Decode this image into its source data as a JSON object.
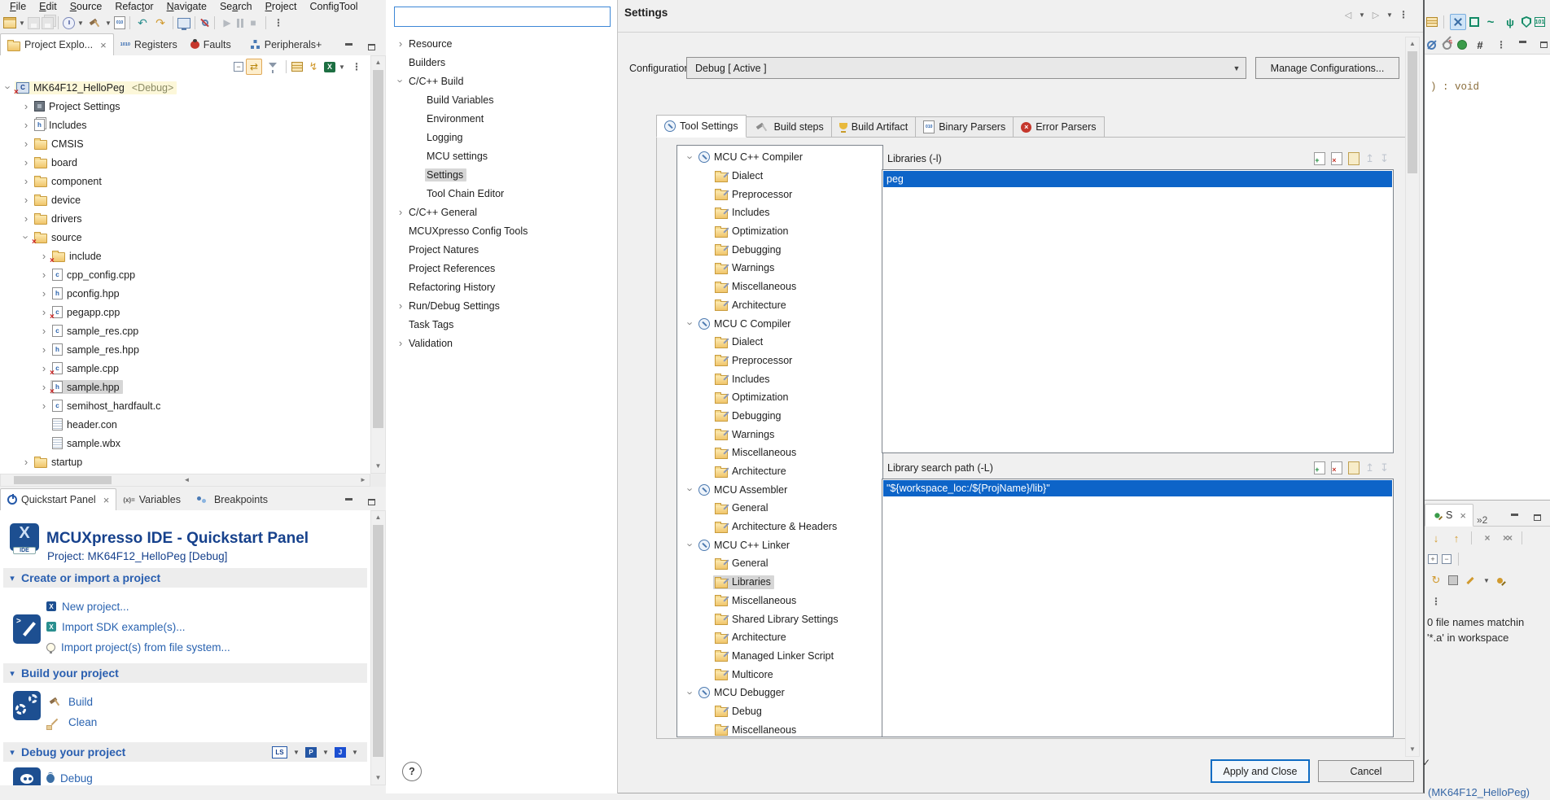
{
  "menu": {
    "items": [
      "File",
      "Edit",
      "Source",
      "Refactor",
      "Navigate",
      "Search",
      "Project",
      "ConfigTool"
    ]
  },
  "main_toolbar": {
    "left_icons": [
      "new-wizard",
      "dropdown",
      "save",
      "save-all",
      "sep",
      "debug-config",
      "dropdown",
      "build-hammer",
      "dropdown",
      "binary-doc",
      "sep",
      "undo",
      "redo",
      "sep",
      "console",
      "sep",
      "search-mark",
      "sep",
      "resume",
      "pause",
      "stop",
      "sep2",
      "overflow"
    ],
    "right_icons": [
      "table-add",
      "sep",
      "dev-tools",
      "green-chip",
      "signal",
      "usb",
      "shield",
      "binary-101"
    ],
    "right_icons2": [
      "skip-breakpoint",
      "skip-s",
      "record-dot",
      "grid-cross",
      "overflow",
      "minimize",
      "maximize"
    ]
  },
  "explorer": {
    "tabs": [
      {
        "label": "Project Explo...",
        "icon": "folder-tab",
        "active": true,
        "close": true
      },
      {
        "label": "Registers",
        "icon": "registers"
      },
      {
        "label": "Faults",
        "icon": "ladybug"
      },
      {
        "label": "Peripherals+",
        "icon": "network"
      }
    ],
    "toolbar_icons": [
      "collapse-all",
      "link-editor",
      "filter",
      "sep",
      "table",
      "sync",
      "excel",
      "dropdown",
      "overflow"
    ],
    "tree": [
      {
        "t": "MK64F12_HelloPeg",
        "sfx": "<Debug>",
        "d": 0,
        "e": "v",
        "i": "proj",
        "hl": true
      },
      {
        "t": "Project Settings",
        "d": 1,
        "e": ">",
        "i": "chip"
      },
      {
        "t": "Includes",
        "d": 1,
        "e": ">",
        "i": "includes"
      },
      {
        "t": "CMSIS",
        "d": 1,
        "e": ">",
        "i": "folder"
      },
      {
        "t": "board",
        "d": 1,
        "e": ">",
        "i": "folder"
      },
      {
        "t": "component",
        "d": 1,
        "e": ">",
        "i": "folder"
      },
      {
        "t": "device",
        "d": 1,
        "e": ">",
        "i": "folder"
      },
      {
        "t": "drivers",
        "d": 1,
        "e": ">",
        "i": "folder"
      },
      {
        "t": "source",
        "d": 1,
        "e": "v",
        "i": "folder-x"
      },
      {
        "t": "include",
        "d": 2,
        "e": ">",
        "i": "folder-x"
      },
      {
        "t": "cpp_config.cpp",
        "d": 2,
        "e": ">",
        "i": "file-c"
      },
      {
        "t": "pconfig.hpp",
        "d": 2,
        "e": ">",
        "i": "file-h"
      },
      {
        "t": "pegapp.cpp",
        "d": 2,
        "e": ">",
        "i": "file-c-x"
      },
      {
        "t": "sample_res.cpp",
        "d": 2,
        "e": ">",
        "i": "file-c"
      },
      {
        "t": "sample_res.hpp",
        "d": 2,
        "e": ">",
        "i": "file-h"
      },
      {
        "t": "sample.cpp",
        "d": 2,
        "e": ">",
        "i": "file-c-x"
      },
      {
        "t": "sample.hpp",
        "d": 2,
        "e": ">",
        "i": "file-h-x",
        "sel": true
      },
      {
        "t": "semihost_hardfault.c",
        "d": 2,
        "e": ">",
        "i": "file-c"
      },
      {
        "t": "header.con",
        "d": 2,
        "i": "doc"
      },
      {
        "t": "sample.wbx",
        "d": 2,
        "i": "doc"
      },
      {
        "t": "startup",
        "d": 1,
        "e": ">",
        "i": "folder"
      }
    ]
  },
  "quickstart": {
    "tabs": [
      {
        "label": "Quickstart Panel",
        "icon": "power",
        "active": true,
        "close": true
      },
      {
        "label": "Variables",
        "icon": "variables"
      },
      {
        "label": "Breakpoints",
        "icon": "breakpoints"
      }
    ],
    "title": "MCUXpresso IDE - Quickstart Panel",
    "subtitle": "Project: MK64F12_HelloPeg [Debug]",
    "sections": [
      {
        "header": "Create or import a project",
        "big_icon": "import-project",
        "links": [
          {
            "label": "New project...",
            "icon": "x-blue"
          },
          {
            "label": "Import SDK example(s)...",
            "icon": "x-teal"
          },
          {
            "label": "Import project(s) from file system...",
            "icon": "bulb"
          }
        ]
      },
      {
        "header": "Build your project",
        "big_icon": "build-gears",
        "links": [
          {
            "label": "Build",
            "icon": "hammer"
          },
          {
            "label": "Clean",
            "icon": "broom"
          }
        ]
      },
      {
        "header": "Debug your project",
        "big_icon": "debug-probe",
        "header_icons": [
          "link-server",
          "dropdown",
          "pemicro",
          "dropdown",
          "jlink",
          "dropdown"
        ],
        "links": [
          {
            "label": "Debug",
            "icon": "bug"
          }
        ]
      }
    ]
  },
  "dialog": {
    "filter_value": "",
    "nav_arrows": [
      "back",
      "dropdown",
      "forward",
      "dropdown",
      "overflow"
    ],
    "nav": [
      {
        "t": "Resource",
        "d": 0,
        "e": ">"
      },
      {
        "t": "Builders",
        "d": 0
      },
      {
        "t": "C/C++ Build",
        "d": 0,
        "e": "v"
      },
      {
        "t": "Build Variables",
        "d": 1
      },
      {
        "t": "Environment",
        "d": 1
      },
      {
        "t": "Logging",
        "d": 1
      },
      {
        "t": "MCU settings",
        "d": 1
      },
      {
        "t": "Settings",
        "d": 1,
        "sel": true
      },
      {
        "t": "Tool Chain Editor",
        "d": 1
      },
      {
        "t": "C/C++ General",
        "d": 0,
        "e": ">"
      },
      {
        "t": "MCUXpresso Config Tools",
        "d": 0
      },
      {
        "t": "Project Natures",
        "d": 0
      },
      {
        "t": "Project References",
        "d": 0
      },
      {
        "t": "Refactoring History",
        "d": 0
      },
      {
        "t": "Run/Debug Settings",
        "d": 0,
        "e": ">"
      },
      {
        "t": "Task Tags",
        "d": 0
      },
      {
        "t": "Validation",
        "d": 0,
        "e": ">"
      }
    ],
    "title": "Settings",
    "config_label": "Configuration:",
    "config_value": "Debug  [ Active ]",
    "manage_button": "Manage Configurations...",
    "tabs": [
      {
        "label": "Tool Settings",
        "icon": "dial",
        "active": true
      },
      {
        "label": "Build steps",
        "icon": "hammer-gray"
      },
      {
        "label": "Build Artifact",
        "icon": "trophy"
      },
      {
        "label": "Binary Parsers",
        "icon": "binary-doc"
      },
      {
        "label": "Error Parsers",
        "icon": "error"
      }
    ],
    "tool_tree": [
      {
        "t": "MCU C++ Compiler",
        "d": 0,
        "e": "v",
        "i": "dial"
      },
      {
        "t": "Dialect",
        "d": 1,
        "i": "tool-folder"
      },
      {
        "t": "Preprocessor",
        "d": 1,
        "i": "tool-folder"
      },
      {
        "t": "Includes",
        "d": 1,
        "i": "tool-folder"
      },
      {
        "t": "Optimization",
        "d": 1,
        "i": "tool-folder"
      },
      {
        "t": "Debugging",
        "d": 1,
        "i": "tool-folder"
      },
      {
        "t": "Warnings",
        "d": 1,
        "i": "tool-folder"
      },
      {
        "t": "Miscellaneous",
        "d": 1,
        "i": "tool-folder"
      },
      {
        "t": "Architecture",
        "d": 1,
        "i": "tool-folder"
      },
      {
        "t": "MCU C Compiler",
        "d": 0,
        "e": "v",
        "i": "dial"
      },
      {
        "t": "Dialect",
        "d": 1,
        "i": "tool-folder"
      },
      {
        "t": "Preprocessor",
        "d": 1,
        "i": "tool-folder"
      },
      {
        "t": "Includes",
        "d": 1,
        "i": "tool-folder"
      },
      {
        "t": "Optimization",
        "d": 1,
        "i": "tool-folder"
      },
      {
        "t": "Debugging",
        "d": 1,
        "i": "tool-folder"
      },
      {
        "t": "Warnings",
        "d": 1,
        "i": "tool-folder"
      },
      {
        "t": "Miscellaneous",
        "d": 1,
        "i": "tool-folder"
      },
      {
        "t": "Architecture",
        "d": 1,
        "i": "tool-folder"
      },
      {
        "t": "MCU Assembler",
        "d": 0,
        "e": "v",
        "i": "dial"
      },
      {
        "t": "General",
        "d": 1,
        "i": "tool-folder"
      },
      {
        "t": "Architecture & Headers",
        "d": 1,
        "i": "tool-folder"
      },
      {
        "t": "MCU C++ Linker",
        "d": 0,
        "e": "v",
        "i": "dial"
      },
      {
        "t": "General",
        "d": 1,
        "i": "tool-folder"
      },
      {
        "t": "Libraries",
        "d": 1,
        "i": "tool-folder",
        "sel": true
      },
      {
        "t": "Miscellaneous",
        "d": 1,
        "i": "tool-folder"
      },
      {
        "t": "Shared Library Settings",
        "d": 1,
        "i": "tool-folder"
      },
      {
        "t": "Architecture",
        "d": 1,
        "i": "tool-folder"
      },
      {
        "t": "Managed Linker Script",
        "d": 1,
        "i": "tool-folder"
      },
      {
        "t": "Multicore",
        "d": 1,
        "i": "tool-folder"
      },
      {
        "t": "MCU Debugger",
        "d": 0,
        "e": "v",
        "i": "dial"
      },
      {
        "t": "Debug",
        "d": 1,
        "i": "tool-folder"
      },
      {
        "t": "Miscellaneous",
        "d": 1,
        "i": "tool-folder"
      }
    ],
    "libraries": {
      "title": "Libraries (-l)",
      "toolbar": [
        "add",
        "delete",
        "edit",
        "move-up",
        "move-down"
      ],
      "rows": [
        "peg"
      ]
    },
    "search_path": {
      "title": "Library search path (-L)",
      "toolbar": [
        "add",
        "delete",
        "edit",
        "move-up",
        "move-down"
      ],
      "rows": [
        "\"${workspace_loc:/${ProjName}/lib}\""
      ]
    },
    "help_button": "?",
    "apply_button": "Apply and Close",
    "cancel_button": "Cancel"
  },
  "editor": {
    "code_fragment": ") : void"
  },
  "search_view": {
    "tabs": [
      {
        "label": "S",
        "icon": "pin-green",
        "active": true,
        "close": true
      },
      {
        "label": "»2"
      }
    ],
    "toolbar1": [
      "arrow-down",
      "arrow-up",
      "sep",
      "remove",
      "remove-all",
      "sep"
    ],
    "toolbar2": [
      "expand-all",
      "collapse-tree",
      "sep"
    ],
    "toolbar3": [
      "refresh",
      "stop-gray",
      "edit-search",
      "dropdown",
      "pin-view"
    ],
    "overflow_icon": "overflow",
    "message_line1": "0 file names matchin",
    "message_line2": "'*.a' in workspace"
  },
  "statusbar": {
    "check": "✓",
    "right_text": "(MK64F12_HelloPeg)"
  }
}
